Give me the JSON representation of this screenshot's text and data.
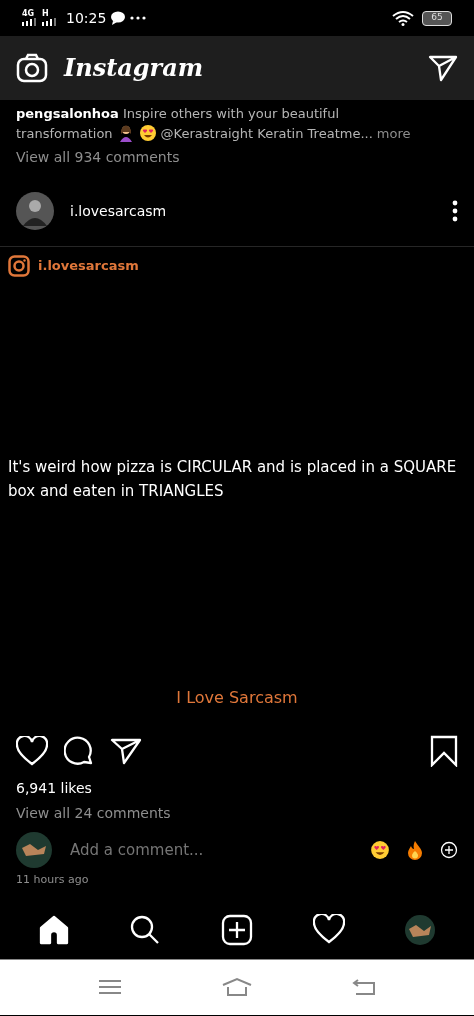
{
  "status_bar": {
    "network_1": "4G",
    "network_2": "H",
    "time": "10:25",
    "battery": "65"
  },
  "header": {
    "title": "Instagram"
  },
  "previous_post": {
    "user": "pengsalonhoa",
    "caption_1": "Inspire others with your beautiful",
    "caption_2": "transformation",
    "caption_3": "@Kerastraight Keratin Treatme...",
    "more": "more",
    "view_comments": "View all 934 comments"
  },
  "post": {
    "username": "i.lovesarcasm",
    "image": {
      "handle": "i.lovesarcasm",
      "quote": "It's weird how pizza is CIRCULAR and is placed in a SQUARE box and eaten in TRIANGLES",
      "footer": "I Love Sarcasm"
    },
    "likes": "6,941 likes",
    "view_comments": "View all 24 comments",
    "comment_placeholder": "Add a comment...",
    "time": "11 hours ago"
  },
  "bottom_nav": [
    {
      "kind": "home",
      "selected": true
    },
    {
      "kind": "search",
      "selected": false
    },
    {
      "kind": "add",
      "selected": false
    },
    {
      "kind": "activity",
      "selected": false
    },
    {
      "kind": "profile",
      "selected": false
    }
  ]
}
